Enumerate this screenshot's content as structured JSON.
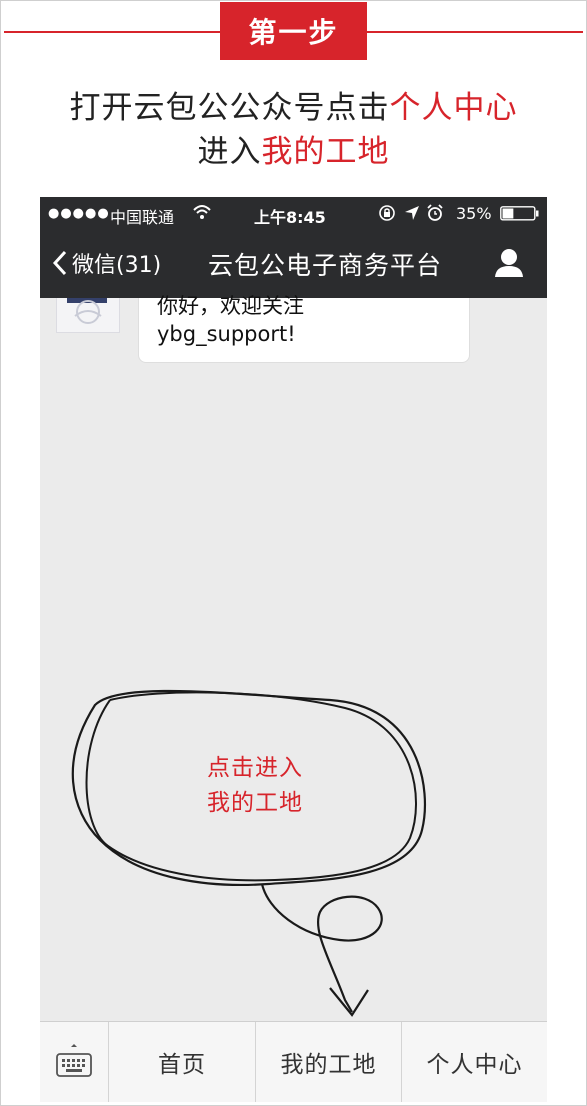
{
  "header": {
    "step_label": "第一步",
    "line1_prefix": "打开云包公公众号点击",
    "line1_highlight": "个人中心",
    "line2_prefix": "进入",
    "line2_highlight": "我的工地",
    "accent_color": "#d7242b"
  },
  "status_bar": {
    "signal": "●●●●●",
    "carrier": "中国联通",
    "time": "上午8:45",
    "battery": "35%",
    "battery_level": 0.35,
    "icons": [
      "wifi-icon",
      "orientation-lock-icon",
      "location-icon",
      "alarm-icon",
      "battery-icon"
    ]
  },
  "nav": {
    "back_label": "微信(31)",
    "title": "云包公电子商务平台",
    "icons": [
      "chevron-left-icon",
      "profile-icon"
    ]
  },
  "chat": {
    "message_line1": "你好，欢迎关注",
    "message_line2": "ybg_support!"
  },
  "annotation": {
    "hint_line1": "点击进入",
    "hint_line2": "我的工地"
  },
  "menu": {
    "items": [
      "首页",
      "我的工地",
      "个人中心"
    ],
    "icons": [
      "keyboard-icon"
    ]
  }
}
